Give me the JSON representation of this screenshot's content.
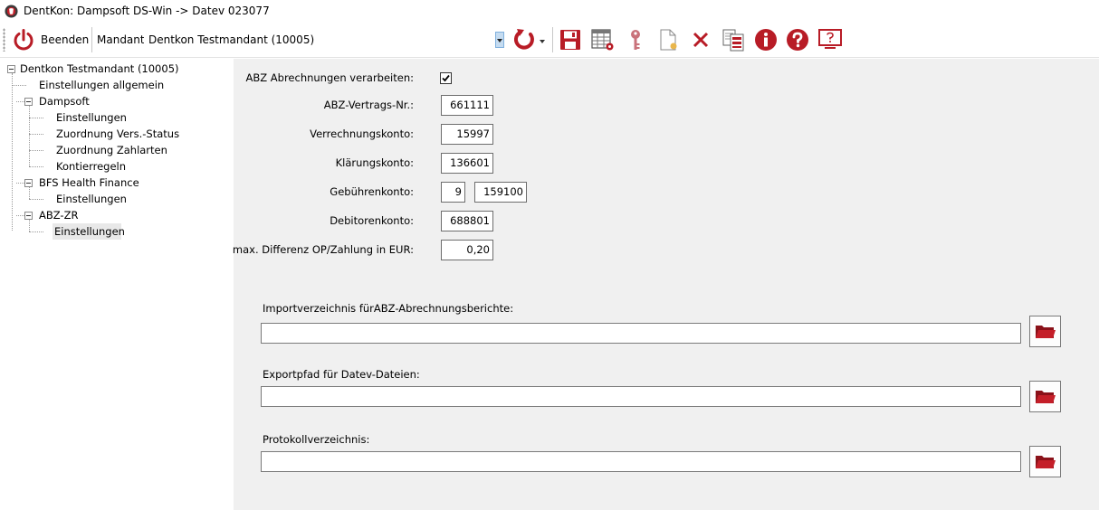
{
  "window": {
    "title": "DentKon: Dampsoft DS-Win -> Datev 023077"
  },
  "toolbar": {
    "beenden_label": "Beenden",
    "mandant_label": "Mandant",
    "mandant_value": "Dentkon Testmandant (10005)",
    "icons": [
      "refresh-icon",
      "save-icon",
      "table-settings-icon",
      "key-icon",
      "new-document-icon",
      "delete-icon",
      "copy-icon",
      "info-icon",
      "help-icon",
      "screen-help-icon"
    ],
    "accent_color": "#b81c26"
  },
  "tree": {
    "root": "Dentkon Testmandant (10005)",
    "items": [
      {
        "label": "Einstellungen allgemein"
      },
      {
        "label": "Dampsoft",
        "children": [
          "Einstellungen",
          "Zuordnung Vers.-Status",
          "Zuordnung Zahlarten",
          "Kontierregeln"
        ]
      },
      {
        "label": "BFS Health Finance",
        "children": [
          "Einstellungen"
        ]
      },
      {
        "label": "ABZ-ZR",
        "children": [
          "Einstellungen"
        ]
      }
    ],
    "selected": "ABZ-ZR / Einstellungen"
  },
  "form": {
    "abz_verarbeiten_label": "ABZ Abrechnungen verarbeiten:",
    "abz_verarbeiten_checked": true,
    "vertragsnr_label": "ABZ-Vertrags-Nr.:",
    "vertragsnr_value": "661111",
    "verrechnungskonto_label": "Verrechnungskonto:",
    "verrechnungskonto_value": "15997",
    "klaerungskonto_label": "Klärungskonto:",
    "klaerungskonto_value": "136601",
    "gebuehrenkonto_label": "Gebührenkonto:",
    "gebuehrenkonto_prefix": "9",
    "gebuehrenkonto_value": "159100",
    "debitorenkonto_label": "Debitorenkonto:",
    "debitorenkonto_value": "688801",
    "maxdiff_label": "max. Differenz OP/Zahlung in EUR:",
    "maxdiff_value": "0,20"
  },
  "paths": {
    "import_label": "Importverzeichnis fürABZ-Abrechnungsberichte:",
    "import_value": "",
    "export_label": "Exportpfad für Datev-Dateien:",
    "export_value": "",
    "protokoll_label": "Protokollverzeichnis:",
    "protokoll_value": ""
  }
}
